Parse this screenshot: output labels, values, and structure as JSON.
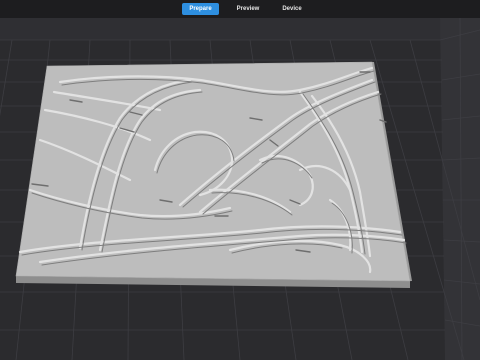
{
  "app": {
    "tabs": [
      {
        "label": "Prepare",
        "active": true
      },
      {
        "label": "Preview",
        "active": false
      },
      {
        "label": "Device",
        "active": false
      }
    ]
  },
  "viewport": {
    "background_color": "#2a2a2d",
    "grid_color": "#3a3a3e",
    "model_color": "#bdbdbd",
    "model_type": "3D terrain relief of road interchange"
  }
}
